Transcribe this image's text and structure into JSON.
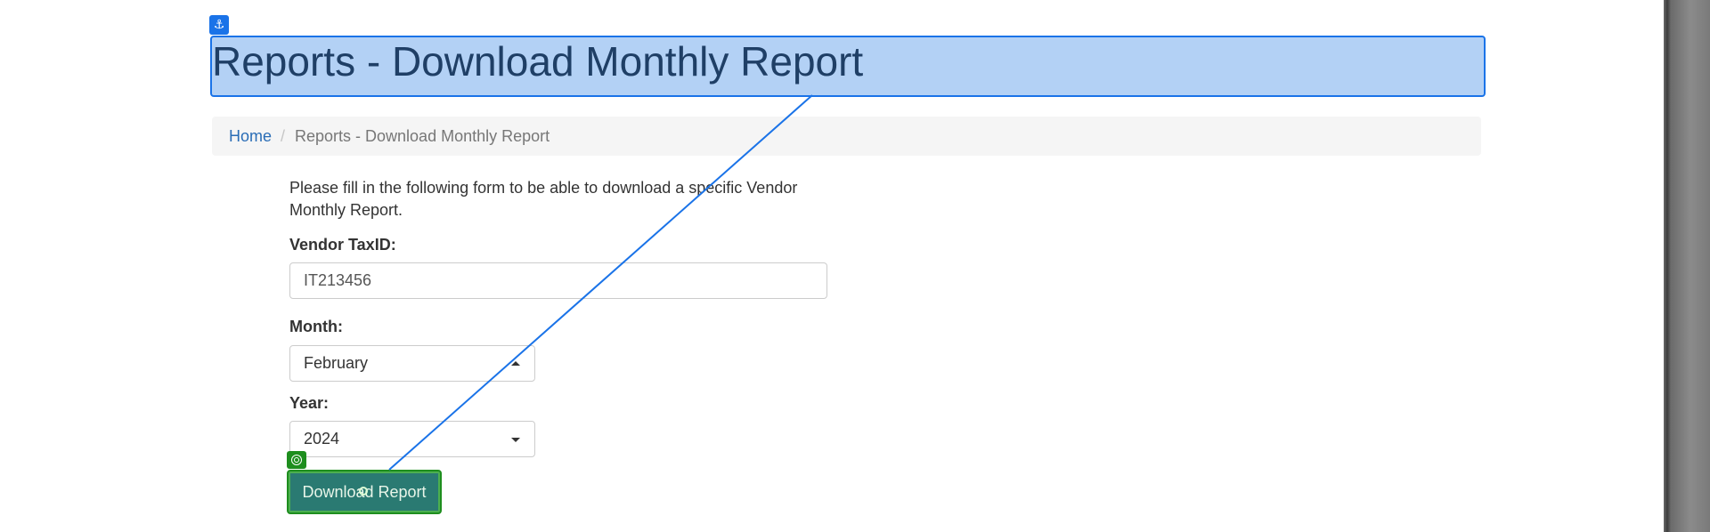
{
  "header": {
    "title": "Reports - Download Monthly Report"
  },
  "breadcrumb": {
    "home": "Home",
    "separator": "/",
    "current": "Reports - Download Monthly Report"
  },
  "form": {
    "intro": "Please fill in the following form to be able to download a specific Vendor Monthly Report.",
    "vendor_label": "Vendor TaxID:",
    "vendor_value": "IT213456",
    "month_label": "Month:",
    "month_value": "February",
    "year_label": "Year:",
    "year_value": "2024",
    "submit_label": "Download Report"
  },
  "overlay": {
    "anchor_icon": "anchor-icon",
    "target_icon": "target-icon",
    "highlight_color": "#1a73e8",
    "target_color": "#1e8e1e"
  }
}
